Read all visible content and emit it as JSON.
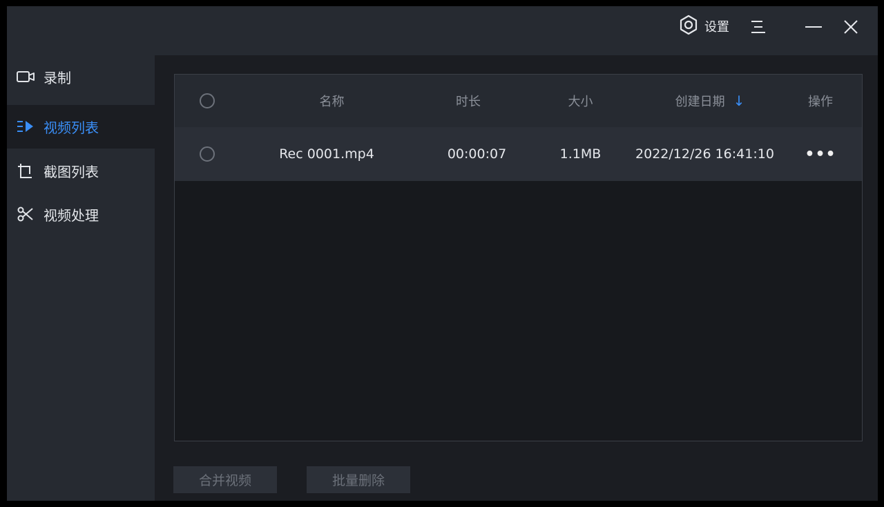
{
  "titlebar": {
    "settings_label": "设置",
    "settings_icon": "gear-ring-icon",
    "menu_icon": "hamburger-menu-icon",
    "minimize_icon": "minimize-icon",
    "close_icon": "close-icon"
  },
  "sidebar": {
    "items": [
      {
        "label": "录制",
        "icon": "camera-icon",
        "active": false
      },
      {
        "label": "视频列表",
        "icon": "video-list-icon",
        "active": true
      },
      {
        "label": "截图列表",
        "icon": "screenshot-icon",
        "active": false
      },
      {
        "label": "视频处理",
        "icon": "video-edit-icon",
        "active": false
      }
    ]
  },
  "table": {
    "columns": {
      "name": "名称",
      "duration": "时长",
      "size": "大小",
      "created": "创建日期",
      "actions": "操作"
    },
    "sort_indicator": "↓",
    "rows": [
      {
        "name": "Rec 0001.mp4",
        "duration": "00:00:07",
        "size": "1.1MB",
        "created": "2022/12/26 16:41:10",
        "actions": "•••"
      }
    ]
  },
  "footer": {
    "merge_label": "合并视频",
    "batch_delete_label": "批量删除"
  },
  "colors": {
    "accent": "#3a8ef6",
    "window_bg": "#262a31",
    "content_bg": "#1b1d22"
  }
}
